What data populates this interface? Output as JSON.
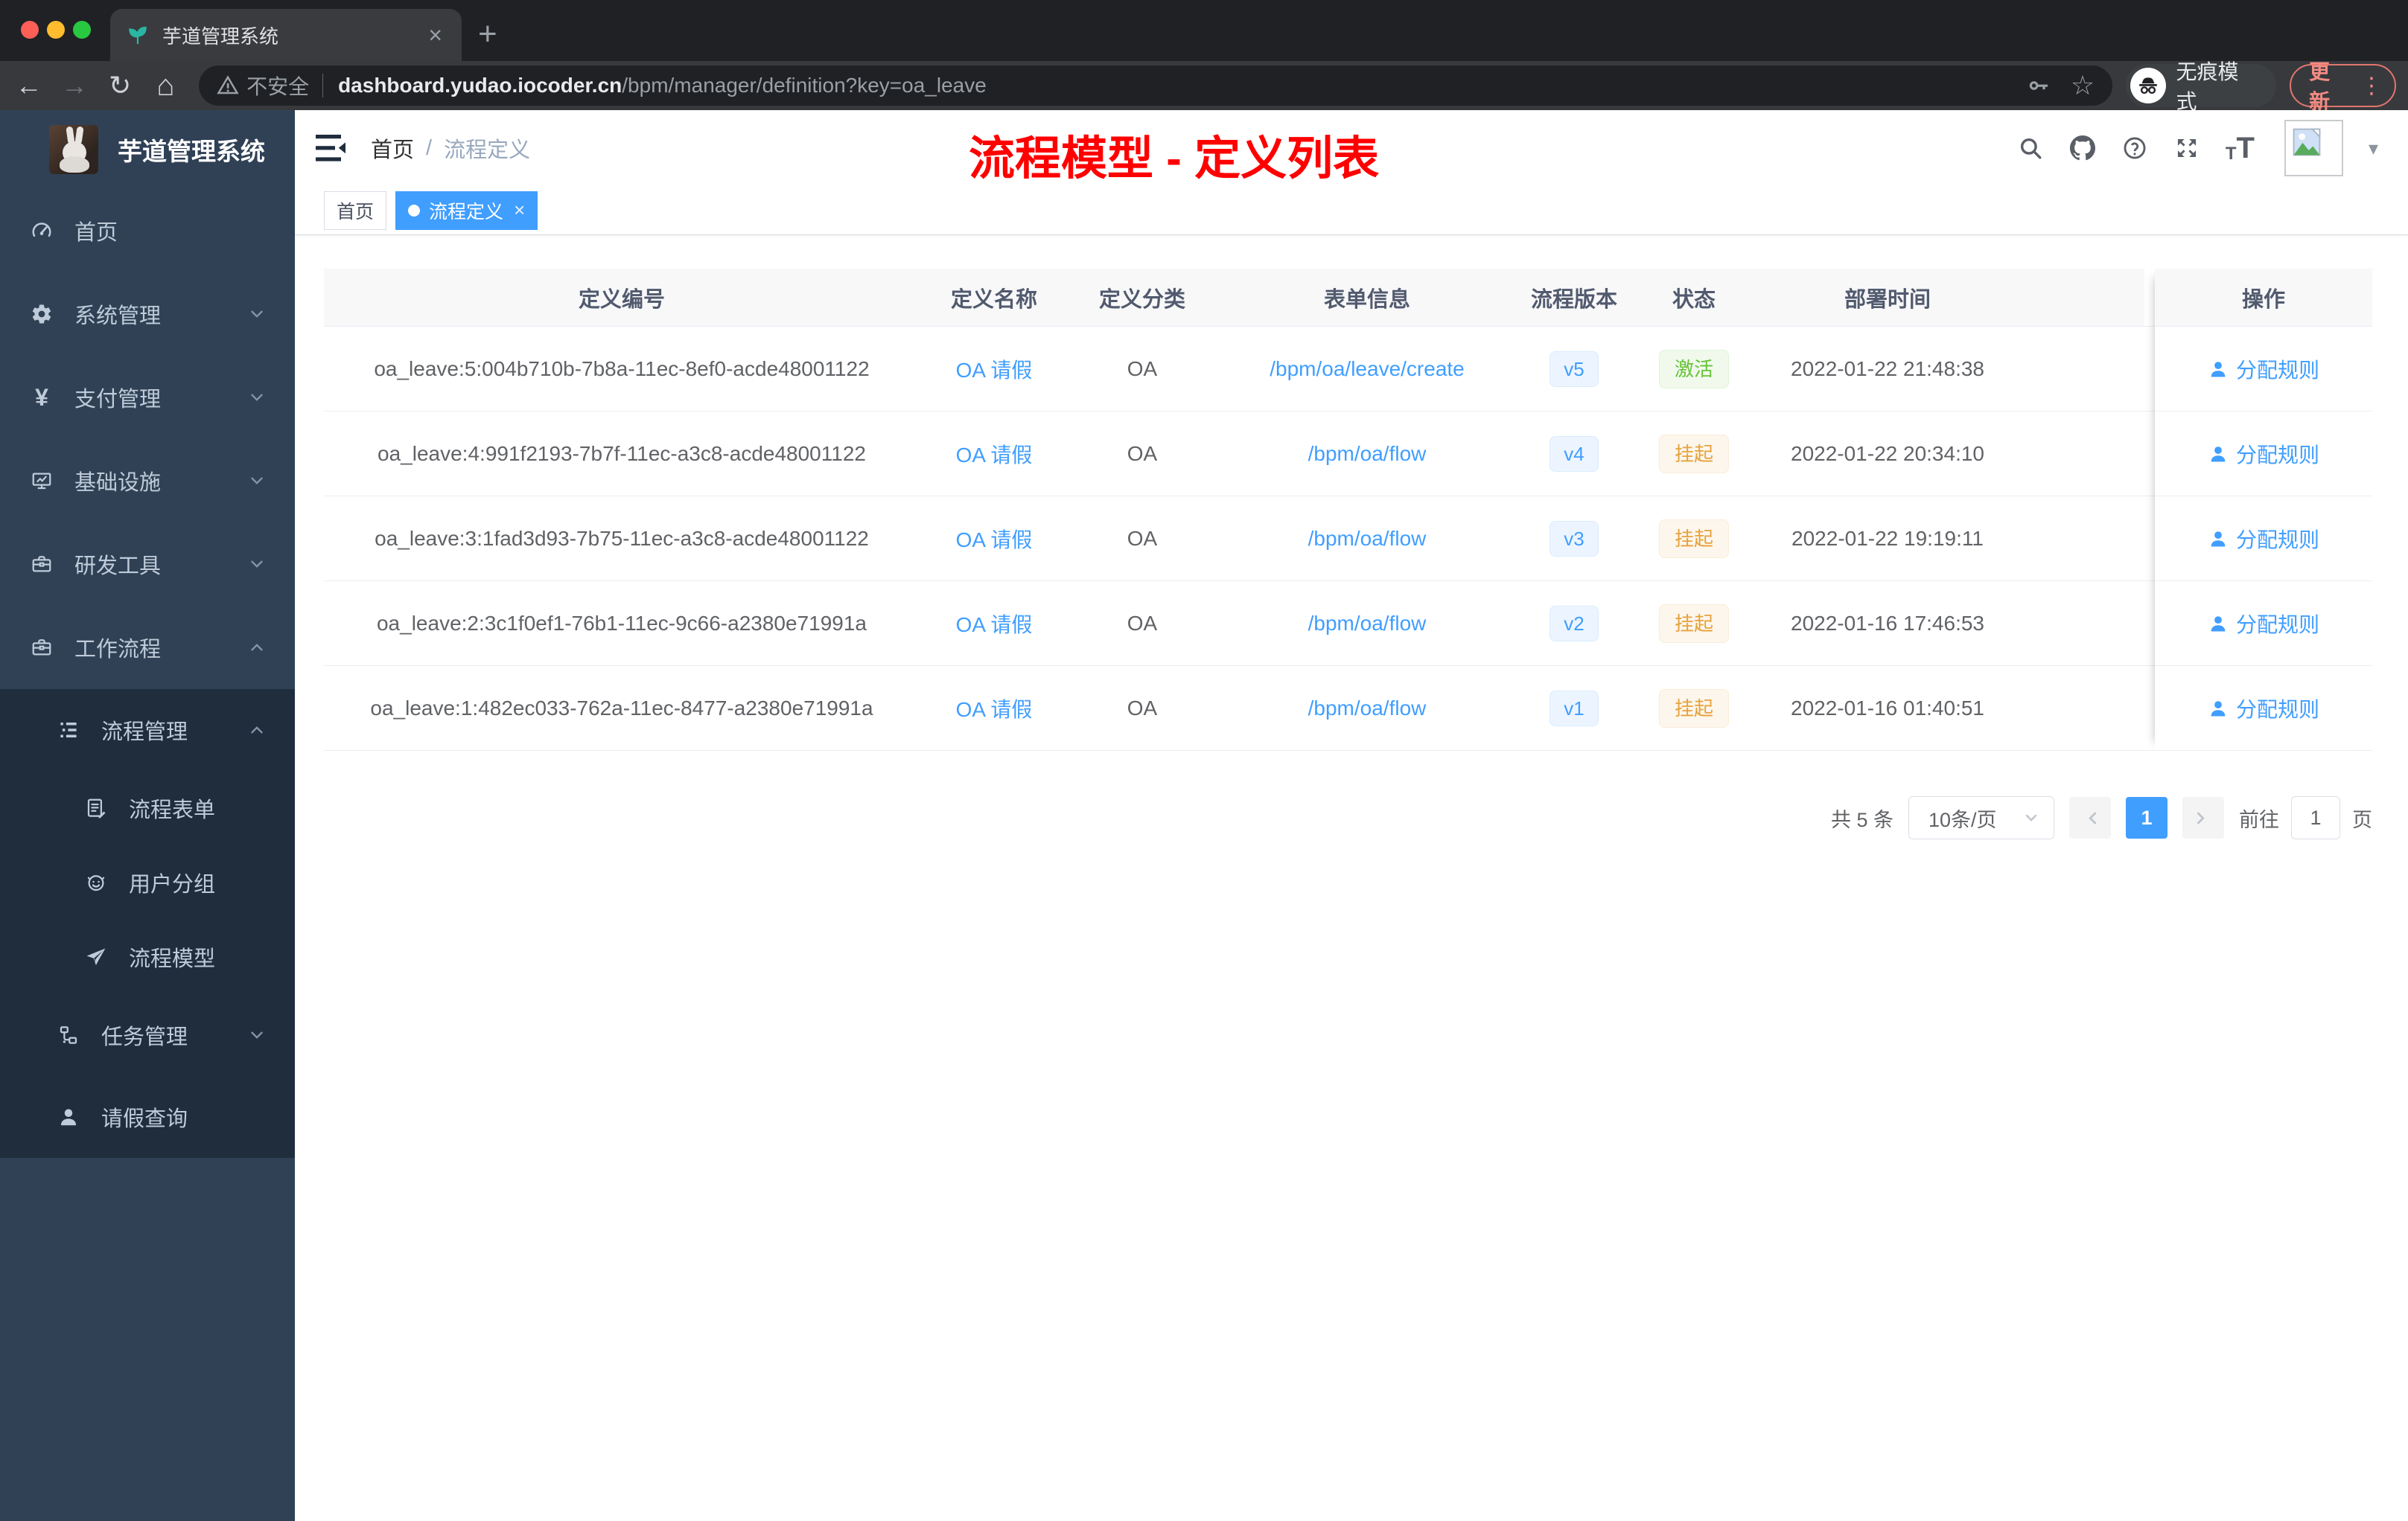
{
  "browser": {
    "tab": {
      "title": "芋道管理系统",
      "close_glyph": "×",
      "new_tab_glyph": "+"
    },
    "toolbar": {
      "security_label": "不安全",
      "url_domain": "dashboard.yudao.iocoder.cn",
      "url_path": "/bpm/manager/definition?key=oa_leave",
      "incognito_label": "无痕模式",
      "update_label": "更新"
    }
  },
  "sidebar": {
    "logo_title": "芋道管理系统",
    "menu": [
      {
        "key": "home",
        "label": "首页",
        "icon": "dashboard-icon",
        "level": 1,
        "chevron": null,
        "sub": false
      },
      {
        "key": "system",
        "label": "系统管理",
        "icon": "gear-icon",
        "level": 1,
        "chevron": "down",
        "sub": false
      },
      {
        "key": "payment",
        "label": "支付管理",
        "icon": "yen-icon",
        "level": 1,
        "chevron": "down",
        "sub": false
      },
      {
        "key": "infra",
        "label": "基础设施",
        "icon": "monitor-icon",
        "level": 1,
        "chevron": "down",
        "sub": false
      },
      {
        "key": "devtools",
        "label": "研发工具",
        "icon": "toolbox-icon",
        "level": 1,
        "chevron": "down",
        "sub": false
      },
      {
        "key": "workflow",
        "label": "工作流程",
        "icon": "toolbox-icon",
        "level": 1,
        "chevron": "up",
        "sub": false
      },
      {
        "key": "process-manage",
        "label": "流程管理",
        "icon": "tree-icon",
        "level": 2,
        "chevron": "up",
        "sub": true
      },
      {
        "key": "process-form",
        "label": "流程表单",
        "icon": "form-icon",
        "level": 3,
        "chevron": null,
        "sub": true
      },
      {
        "key": "user-group",
        "label": "用户分组",
        "icon": "group-icon",
        "level": 3,
        "chevron": null,
        "sub": true
      },
      {
        "key": "process-model",
        "label": "流程模型",
        "icon": "send-icon",
        "level": 3,
        "chevron": null,
        "sub": true
      },
      {
        "key": "task-manage",
        "label": "任务管理",
        "icon": "org-icon",
        "level": 2,
        "chevron": "down",
        "sub": true
      },
      {
        "key": "leave-query",
        "label": "请假查询",
        "icon": "user-icon",
        "level": 2,
        "chevron": null,
        "sub": true
      }
    ]
  },
  "navbar": {
    "breadcrumb": [
      "首页",
      "流程定义"
    ],
    "separator": "/"
  },
  "annotation": {
    "text": "流程模型 - 定义列表",
    "color": "#ff0000"
  },
  "tags": [
    {
      "label": "首页",
      "active": false
    },
    {
      "label": "流程定义",
      "active": true
    }
  ],
  "table": {
    "columns": [
      "定义编号",
      "定义名称",
      "定义分类",
      "表单信息",
      "流程版本",
      "状态",
      "部署时间",
      "操作"
    ],
    "rows": [
      {
        "id": "oa_leave:5:004b710b-7b8a-11ec-8ef0-acde48001122",
        "name": "OA 请假",
        "category": "OA",
        "form": "/bpm/oa/leave/create",
        "version": "v5",
        "status": "激活",
        "status_type": "success",
        "time": "2022-01-22 21:48:38",
        "action": "分配规则"
      },
      {
        "id": "oa_leave:4:991f2193-7b7f-11ec-a3c8-acde48001122",
        "name": "OA 请假",
        "category": "OA",
        "form": "/bpm/oa/flow",
        "version": "v4",
        "status": "挂起",
        "status_type": "warning",
        "time": "2022-01-22 20:34:10",
        "action": "分配规则"
      },
      {
        "id": "oa_leave:3:1fad3d93-7b75-11ec-a3c8-acde48001122",
        "name": "OA 请假",
        "category": "OA",
        "form": "/bpm/oa/flow",
        "version": "v3",
        "status": "挂起",
        "status_type": "warning",
        "time": "2022-01-22 19:19:11",
        "action": "分配规则"
      },
      {
        "id": "oa_leave:2:3c1f0ef1-76b1-11ec-9c66-a2380e71991a",
        "name": "OA 请假",
        "category": "OA",
        "form": "/bpm/oa/flow",
        "version": "v2",
        "status": "挂起",
        "status_type": "warning",
        "time": "2022-01-16 17:46:53",
        "action": "分配规则"
      },
      {
        "id": "oa_leave:1:482ec033-762a-11ec-8477-a2380e71991a",
        "name": "OA 请假",
        "category": "OA",
        "form": "/bpm/oa/flow",
        "version": "v1",
        "status": "挂起",
        "status_type": "warning",
        "time": "2022-01-16 01:40:51",
        "action": "分配规则"
      }
    ]
  },
  "pagination": {
    "total": "共 5 条",
    "page_size": "10条/页",
    "current": "1",
    "goto_label": "前往",
    "goto_value": "1",
    "unit_label": "页"
  },
  "colors": {
    "accent": "#409eff",
    "annotation_red": "#ff0000",
    "status_active": "#67c23a",
    "status_suspend": "#e6a23c",
    "sidebar_bg": "#304156",
    "submenu_bg": "#1f2d3d",
    "version_badge_bg": "#ecf5ff",
    "active_badge_bg": "#f0f9eb",
    "suspend_badge_bg": "#fdf6ec"
  }
}
